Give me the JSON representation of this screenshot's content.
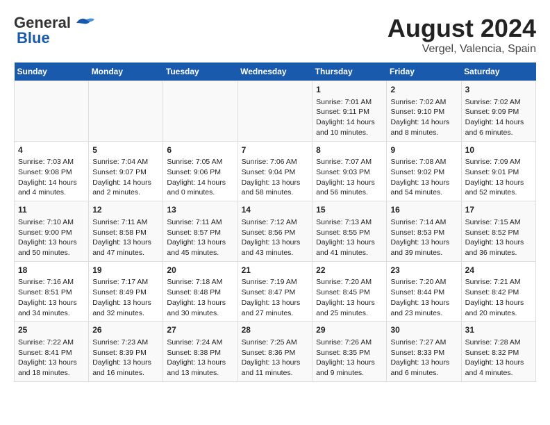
{
  "header": {
    "logo_general": "General",
    "logo_blue": "Blue",
    "month_year": "August 2024",
    "location": "Vergel, Valencia, Spain"
  },
  "days_of_week": [
    "Sunday",
    "Monday",
    "Tuesday",
    "Wednesday",
    "Thursday",
    "Friday",
    "Saturday"
  ],
  "weeks": [
    [
      {
        "day": "",
        "content": ""
      },
      {
        "day": "",
        "content": ""
      },
      {
        "day": "",
        "content": ""
      },
      {
        "day": "",
        "content": ""
      },
      {
        "day": "1",
        "sunrise": "Sunrise: 7:01 AM",
        "sunset": "Sunset: 9:11 PM",
        "daylight": "Daylight: 14 hours and 10 minutes."
      },
      {
        "day": "2",
        "sunrise": "Sunrise: 7:02 AM",
        "sunset": "Sunset: 9:10 PM",
        "daylight": "Daylight: 14 hours and 8 minutes."
      },
      {
        "day": "3",
        "sunrise": "Sunrise: 7:02 AM",
        "sunset": "Sunset: 9:09 PM",
        "daylight": "Daylight: 14 hours and 6 minutes."
      }
    ],
    [
      {
        "day": "4",
        "sunrise": "Sunrise: 7:03 AM",
        "sunset": "Sunset: 9:08 PM",
        "daylight": "Daylight: 14 hours and 4 minutes."
      },
      {
        "day": "5",
        "sunrise": "Sunrise: 7:04 AM",
        "sunset": "Sunset: 9:07 PM",
        "daylight": "Daylight: 14 hours and 2 minutes."
      },
      {
        "day": "6",
        "sunrise": "Sunrise: 7:05 AM",
        "sunset": "Sunset: 9:06 PM",
        "daylight": "Daylight: 14 hours and 0 minutes."
      },
      {
        "day": "7",
        "sunrise": "Sunrise: 7:06 AM",
        "sunset": "Sunset: 9:04 PM",
        "daylight": "Daylight: 13 hours and 58 minutes."
      },
      {
        "day": "8",
        "sunrise": "Sunrise: 7:07 AM",
        "sunset": "Sunset: 9:03 PM",
        "daylight": "Daylight: 13 hours and 56 minutes."
      },
      {
        "day": "9",
        "sunrise": "Sunrise: 7:08 AM",
        "sunset": "Sunset: 9:02 PM",
        "daylight": "Daylight: 13 hours and 54 minutes."
      },
      {
        "day": "10",
        "sunrise": "Sunrise: 7:09 AM",
        "sunset": "Sunset: 9:01 PM",
        "daylight": "Daylight: 13 hours and 52 minutes."
      }
    ],
    [
      {
        "day": "11",
        "sunrise": "Sunrise: 7:10 AM",
        "sunset": "Sunset: 9:00 PM",
        "daylight": "Daylight: 13 hours and 50 minutes."
      },
      {
        "day": "12",
        "sunrise": "Sunrise: 7:11 AM",
        "sunset": "Sunset: 8:58 PM",
        "daylight": "Daylight: 13 hours and 47 minutes."
      },
      {
        "day": "13",
        "sunrise": "Sunrise: 7:11 AM",
        "sunset": "Sunset: 8:57 PM",
        "daylight": "Daylight: 13 hours and 45 minutes."
      },
      {
        "day": "14",
        "sunrise": "Sunrise: 7:12 AM",
        "sunset": "Sunset: 8:56 PM",
        "daylight": "Daylight: 13 hours and 43 minutes."
      },
      {
        "day": "15",
        "sunrise": "Sunrise: 7:13 AM",
        "sunset": "Sunset: 8:55 PM",
        "daylight": "Daylight: 13 hours and 41 minutes."
      },
      {
        "day": "16",
        "sunrise": "Sunrise: 7:14 AM",
        "sunset": "Sunset: 8:53 PM",
        "daylight": "Daylight: 13 hours and 39 minutes."
      },
      {
        "day": "17",
        "sunrise": "Sunrise: 7:15 AM",
        "sunset": "Sunset: 8:52 PM",
        "daylight": "Daylight: 13 hours and 36 minutes."
      }
    ],
    [
      {
        "day": "18",
        "sunrise": "Sunrise: 7:16 AM",
        "sunset": "Sunset: 8:51 PM",
        "daylight": "Daylight: 13 hours and 34 minutes."
      },
      {
        "day": "19",
        "sunrise": "Sunrise: 7:17 AM",
        "sunset": "Sunset: 8:49 PM",
        "daylight": "Daylight: 13 hours and 32 minutes."
      },
      {
        "day": "20",
        "sunrise": "Sunrise: 7:18 AM",
        "sunset": "Sunset: 8:48 PM",
        "daylight": "Daylight: 13 hours and 30 minutes."
      },
      {
        "day": "21",
        "sunrise": "Sunrise: 7:19 AM",
        "sunset": "Sunset: 8:47 PM",
        "daylight": "Daylight: 13 hours and 27 minutes."
      },
      {
        "day": "22",
        "sunrise": "Sunrise: 7:20 AM",
        "sunset": "Sunset: 8:45 PM",
        "daylight": "Daylight: 13 hours and 25 minutes."
      },
      {
        "day": "23",
        "sunrise": "Sunrise: 7:20 AM",
        "sunset": "Sunset: 8:44 PM",
        "daylight": "Daylight: 13 hours and 23 minutes."
      },
      {
        "day": "24",
        "sunrise": "Sunrise: 7:21 AM",
        "sunset": "Sunset: 8:42 PM",
        "daylight": "Daylight: 13 hours and 20 minutes."
      }
    ],
    [
      {
        "day": "25",
        "sunrise": "Sunrise: 7:22 AM",
        "sunset": "Sunset: 8:41 PM",
        "daylight": "Daylight: 13 hours and 18 minutes."
      },
      {
        "day": "26",
        "sunrise": "Sunrise: 7:23 AM",
        "sunset": "Sunset: 8:39 PM",
        "daylight": "Daylight: 13 hours and 16 minutes."
      },
      {
        "day": "27",
        "sunrise": "Sunrise: 7:24 AM",
        "sunset": "Sunset: 8:38 PM",
        "daylight": "Daylight: 13 hours and 13 minutes."
      },
      {
        "day": "28",
        "sunrise": "Sunrise: 7:25 AM",
        "sunset": "Sunset: 8:36 PM",
        "daylight": "Daylight: 13 hours and 11 minutes."
      },
      {
        "day": "29",
        "sunrise": "Sunrise: 7:26 AM",
        "sunset": "Sunset: 8:35 PM",
        "daylight": "Daylight: 13 hours and 9 minutes."
      },
      {
        "day": "30",
        "sunrise": "Sunrise: 7:27 AM",
        "sunset": "Sunset: 8:33 PM",
        "daylight": "Daylight: 13 hours and 6 minutes."
      },
      {
        "day": "31",
        "sunrise": "Sunrise: 7:28 AM",
        "sunset": "Sunset: 8:32 PM",
        "daylight": "Daylight: 13 hours and 4 minutes."
      }
    ]
  ]
}
